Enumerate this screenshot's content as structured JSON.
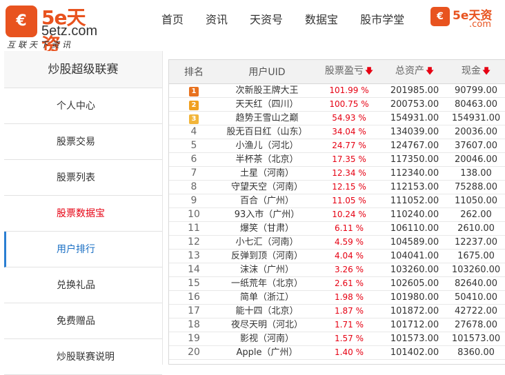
{
  "header": {
    "logo_mark": "€",
    "logo_text": "5e天资",
    "logo_site": "5etz.com",
    "logo_slogan": "互联天下资讯",
    "nav": [
      "首页",
      "资讯",
      "天资号",
      "数据宝",
      "股市学堂"
    ],
    "logo2_text": "5e天资",
    "logo2_site": ".com"
  },
  "sidebar": {
    "title": "炒股超级联赛",
    "items": [
      {
        "label": "个人中心"
      },
      {
        "label": "股票交易"
      },
      {
        "label": "股票列表"
      },
      {
        "label": "股票数据宝"
      },
      {
        "label": "用户排行"
      },
      {
        "label": "兑换礼品"
      },
      {
        "label": "免费赠品"
      },
      {
        "label": "炒股联赛说明"
      }
    ]
  },
  "table": {
    "headers": [
      "排名",
      "用户UID",
      "股票盈亏",
      "总资产",
      "现金"
    ],
    "sort_arrow": "🡇",
    "rows": [
      {
        "rank": "1",
        "user": "次新股王牌大王",
        "profit": "101.99 %",
        "assets": "201985.00",
        "cash": "90799.00"
      },
      {
        "rank": "2",
        "user": "天天红（四川）",
        "profit": "100.75 %",
        "assets": "200753.00",
        "cash": "80463.00"
      },
      {
        "rank": "3",
        "user": "趋势王雪山之巅",
        "profit": "54.93 %",
        "assets": "154931.00",
        "cash": "154931.00"
      },
      {
        "rank": "4",
        "user": "股无百日红（山东）",
        "profit": "34.04 %",
        "assets": "134039.00",
        "cash": "20036.00"
      },
      {
        "rank": "5",
        "user": "小渔儿（河北）",
        "profit": "24.77 %",
        "assets": "124767.00",
        "cash": "37607.00"
      },
      {
        "rank": "6",
        "user": "半杯茶（北京）",
        "profit": "17.35 %",
        "assets": "117350.00",
        "cash": "20046.00"
      },
      {
        "rank": "7",
        "user": "土星（河南）",
        "profit": "12.34 %",
        "assets": "112340.00",
        "cash": "138.00"
      },
      {
        "rank": "8",
        "user": "守望天空（河南）",
        "profit": "12.15 %",
        "assets": "112153.00",
        "cash": "75288.00"
      },
      {
        "rank": "9",
        "user": "百合（广州）",
        "profit": "11.05 %",
        "assets": "111052.00",
        "cash": "11050.00"
      },
      {
        "rank": "10",
        "user": "93入市（广州）",
        "profit": "10.24 %",
        "assets": "110240.00",
        "cash": "262.00"
      },
      {
        "rank": "11",
        "user": "爆笑（甘肃）",
        "profit": "6.11 %",
        "assets": "106110.00",
        "cash": "2610.00"
      },
      {
        "rank": "12",
        "user": "小七汇（河南）",
        "profit": "4.59 %",
        "assets": "104589.00",
        "cash": "12237.00"
      },
      {
        "rank": "13",
        "user": "反弹到顶（河南）",
        "profit": "4.04 %",
        "assets": "104041.00",
        "cash": "1675.00"
      },
      {
        "rank": "14",
        "user": "沫沫（广州）",
        "profit": "3.26 %",
        "assets": "103260.00",
        "cash": "103260.00"
      },
      {
        "rank": "15",
        "user": "一纸荒年（北京）",
        "profit": "2.61 %",
        "assets": "102605.00",
        "cash": "82640.00"
      },
      {
        "rank": "16",
        "user": "简单（浙江）",
        "profit": "1.98 %",
        "assets": "101980.00",
        "cash": "50410.00"
      },
      {
        "rank": "17",
        "user": "能十四（北京）",
        "profit": "1.87 %",
        "assets": "101872.00",
        "cash": "42722.00"
      },
      {
        "rank": "18",
        "user": "夜尽天明（河北）",
        "profit": "1.71 %",
        "assets": "101712.00",
        "cash": "27678.00"
      },
      {
        "rank": "19",
        "user": "影视（河南）",
        "profit": "1.57 %",
        "assets": "101573.00",
        "cash": "101573.00"
      },
      {
        "rank": "20",
        "user": "Apple（广州）",
        "profit": "1.40 %",
        "assets": "101402.00",
        "cash": "8360.00"
      }
    ]
  },
  "colors": {
    "brand": "#e8531f",
    "profit": "#e60012",
    "active": "#1a6fc4"
  }
}
